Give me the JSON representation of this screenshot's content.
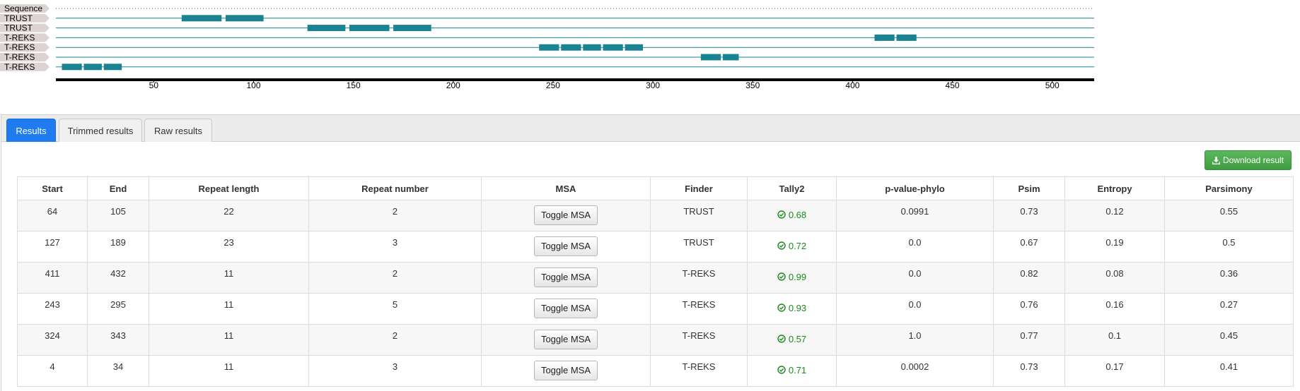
{
  "viewer": {
    "tracks": [
      {
        "label": "Sequence",
        "regions": []
      },
      {
        "label": "TRUST",
        "regions": [
          [
            64,
            84
          ],
          [
            86,
            105
          ]
        ]
      },
      {
        "label": "TRUST",
        "regions": [
          [
            127,
            146
          ],
          [
            148,
            168
          ],
          [
            170,
            189
          ]
        ]
      },
      {
        "label": "T-REKS",
        "regions": [
          [
            411,
            421
          ],
          [
            422,
            432
          ]
        ]
      },
      {
        "label": "T-REKS",
        "regions": [
          [
            243,
            253
          ],
          [
            254,
            264
          ],
          [
            265,
            274
          ],
          [
            275,
            285
          ],
          [
            286,
            295
          ]
        ]
      },
      {
        "label": "T-REKS",
        "regions": [
          [
            324,
            334
          ],
          [
            335,
            343
          ]
        ]
      },
      {
        "label": "T-REKS",
        "regions": [
          [
            4,
            14
          ],
          [
            15,
            24
          ],
          [
            25,
            34
          ]
        ]
      }
    ],
    "axis": {
      "min": 1,
      "max": 521,
      "ticks": [
        50,
        100,
        150,
        200,
        250,
        300,
        350,
        400,
        450,
        500
      ]
    },
    "colors": {
      "region": "#1a8391",
      "track_line": "#1a8391",
      "label_bg": "#ddd3d3"
    }
  },
  "tabs": [
    {
      "label": "Results",
      "active": true
    },
    {
      "label": "Trimmed results",
      "active": false
    },
    {
      "label": "Raw results",
      "active": false
    }
  ],
  "download_label": "Download result",
  "table": {
    "headers": [
      "Start",
      "End",
      "Repeat length",
      "Repeat number",
      "MSA",
      "Finder",
      "Tally2",
      "p-value-phylo",
      "Psim",
      "Entropy",
      "Parsimony"
    ],
    "toggle_label": "Toggle MSA",
    "rows": [
      {
        "start": "64",
        "end": "105",
        "length": "22",
        "number": "2",
        "finder": "TRUST",
        "tally": "0.68",
        "pvalue": "0.0991",
        "psim": "0.73",
        "entropy": "0.12",
        "parsimony": "0.55"
      },
      {
        "start": "127",
        "end": "189",
        "length": "23",
        "number": "3",
        "finder": "TRUST",
        "tally": "0.72",
        "pvalue": "0.0",
        "psim": "0.67",
        "entropy": "0.19",
        "parsimony": "0.5"
      },
      {
        "start": "411",
        "end": "432",
        "length": "11",
        "number": "2",
        "finder": "T-REKS",
        "tally": "0.99",
        "pvalue": "0.0",
        "psim": "0.82",
        "entropy": "0.08",
        "parsimony": "0.36"
      },
      {
        "start": "243",
        "end": "295",
        "length": "11",
        "number": "5",
        "finder": "T-REKS",
        "tally": "0.93",
        "pvalue": "0.0",
        "psim": "0.76",
        "entropy": "0.16",
        "parsimony": "0.27"
      },
      {
        "start": "324",
        "end": "343",
        "length": "11",
        "number": "2",
        "finder": "T-REKS",
        "tally": "0.57",
        "pvalue": "1.0",
        "psim": "0.77",
        "entropy": "0.1",
        "parsimony": "0.45"
      },
      {
        "start": "4",
        "end": "34",
        "length": "11",
        "number": "3",
        "finder": "T-REKS",
        "tally": "0.71",
        "pvalue": "0.0002",
        "psim": "0.73",
        "entropy": "0.17",
        "parsimony": "0.41"
      }
    ]
  }
}
